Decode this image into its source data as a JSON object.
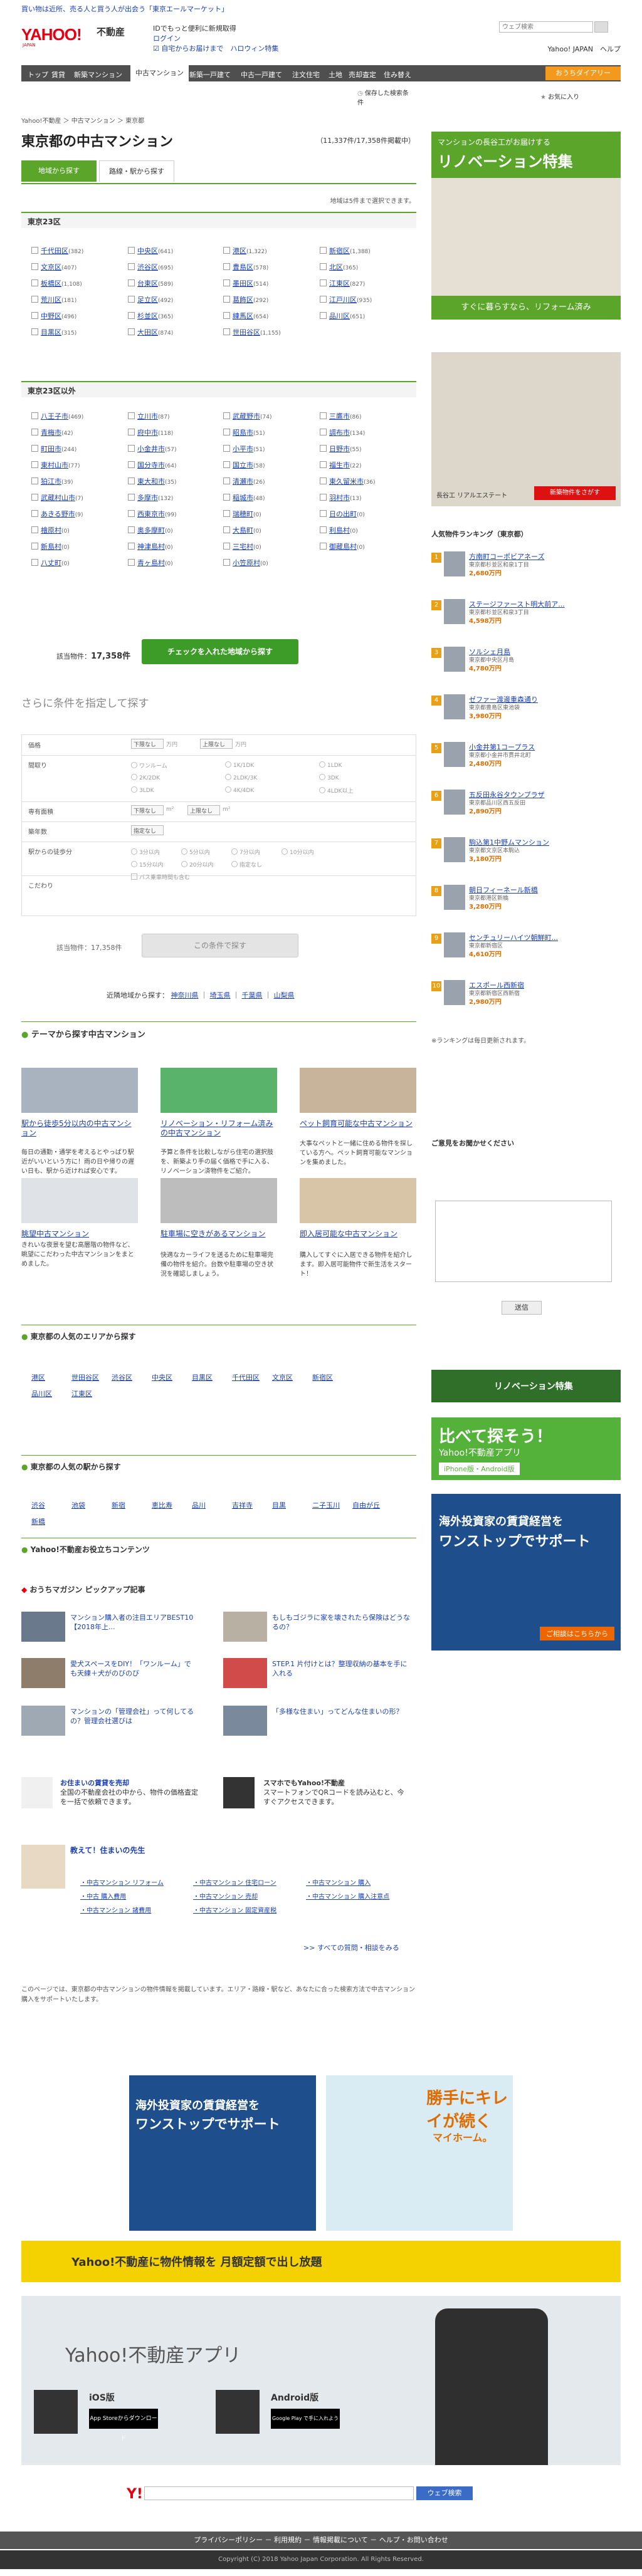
{
  "top_notice": "買い物は近所、売る人と買う人が出会う「東京エールマーケット」",
  "header": {
    "logo": "YAHOO!",
    "logo_sub": "JAPAN",
    "logo_fd": "不動産",
    "link1": "IDでもっと便利に新規取得",
    "link2": "ログイン",
    "link3": "☑ 自宅からお届けまで　ハロウィン特集",
    "search_placeholder": "ウェブ検索",
    "right_links": "Yahoo! JAPAN　ヘルプ"
  },
  "nav": {
    "items": [
      "トップ",
      "賃貸",
      "新築マンション",
      "中古マンション",
      "新築一戸建て",
      "中古一戸建て",
      "注文住宅",
      "土地",
      "売却査定",
      "住み替え"
    ],
    "okini": "おうちダイアリー"
  },
  "subnav": {
    "history": "保存した検索条件",
    "favorite": "お気に入り"
  },
  "breadcrumb": "Yahoo!不動産 ＞ 中古マンション ＞ 東京都",
  "page_title": "東京都の中古マンション",
  "count_line": "（11,337件/17,358件掲載中）",
  "tabs": {
    "area": "地域から探す",
    "train": "路線・駅から探す"
  },
  "area_note": "地域は5件まで選択できます。",
  "sec23": "東京23区",
  "wards23": [
    [
      "千代田区",
      "(382)"
    ],
    [
      "中央区",
      "(641)"
    ],
    [
      "港区",
      "(1,322)"
    ],
    [
      "新宿区",
      "(1,388)"
    ],
    [
      "文京区",
      "(407)"
    ],
    [
      "渋谷区",
      "(695)"
    ],
    [
      "豊島区",
      "(578)"
    ],
    [
      "北区",
      "(365)"
    ],
    [
      "板橋区",
      "(1,108)"
    ],
    [
      "台東区",
      "(589)"
    ],
    [
      "墨田区",
      "(514)"
    ],
    [
      "江東区",
      "(827)"
    ],
    [
      "荒川区",
      "(181)"
    ],
    [
      "足立区",
      "(492)"
    ],
    [
      "葛飾区",
      "(292)"
    ],
    [
      "江戸川区",
      "(935)"
    ],
    [
      "中野区",
      "(496)"
    ],
    [
      "杉並区",
      "(365)"
    ],
    [
      "練馬区",
      "(654)"
    ],
    [
      "品川区",
      "(651)"
    ],
    [
      "目黒区",
      "(315)"
    ],
    [
      "大田区",
      "(874)"
    ],
    [
      "世田谷区",
      "(1,155)"
    ],
    [
      "",
      ""
    ]
  ],
  "secOther": "東京23区以外",
  "wardsOther": [
    [
      "八王子市",
      "(469)"
    ],
    [
      "立川市",
      "(87)"
    ],
    [
      "武蔵野市",
      "(74)"
    ],
    [
      "三鷹市",
      "(86)"
    ],
    [
      "青梅市",
      "(42)"
    ],
    [
      "府中市",
      "(118)"
    ],
    [
      "昭島市",
      "(51)"
    ],
    [
      "調布市",
      "(134)"
    ],
    [
      "町田市",
      "(244)"
    ],
    [
      "小金井市",
      "(57)"
    ],
    [
      "小平市",
      "(51)"
    ],
    [
      "日野市",
      "(55)"
    ],
    [
      "東村山市",
      "(77)"
    ],
    [
      "国分寺市",
      "(64)"
    ],
    [
      "国立市",
      "(58)"
    ],
    [
      "福生市",
      "(22)"
    ],
    [
      "狛江市",
      "(39)"
    ],
    [
      "東大和市",
      "(35)"
    ],
    [
      "清瀬市",
      "(26)"
    ],
    [
      "東久留米市",
      "(36)"
    ],
    [
      "武蔵村山市",
      "(7)"
    ],
    [
      "多摩市",
      "(132)"
    ],
    [
      "稲城市",
      "(48)"
    ],
    [
      "羽村市",
      "(13)"
    ],
    [
      "あきる野市",
      "(9)"
    ],
    [
      "西東京市",
      "(99)"
    ],
    [
      "瑞穂町",
      "(0)"
    ],
    [
      "日の出町",
      "(0)"
    ],
    [
      "檜原村",
      "(0)"
    ],
    [
      "奥多摩町",
      "(0)"
    ],
    [
      "大島町",
      "(0)"
    ],
    [
      "利島村",
      "(0)"
    ],
    [
      "新島村",
      "(0)"
    ],
    [
      "神津島村",
      "(0)"
    ],
    [
      "三宅村",
      "(0)"
    ],
    [
      "御蔵島村",
      "(0)"
    ],
    [
      "八丈町",
      "(0)"
    ],
    [
      "青ヶ島村",
      "(0)"
    ],
    [
      "小笠原村",
      "(0)"
    ],
    [
      "",
      ""
    ]
  ],
  "hit_count_label": "該当物件：",
  "hit_count": "17,358件",
  "check_btn": "チェックを入れた地域から探す",
  "more_cond_title": "さらに条件を指定して探す",
  "cond_labels": [
    "価格",
    "間取り",
    "専有面積",
    "築年数",
    "駅からの徒歩分",
    "こだわり"
  ],
  "cond_select_min": "下限なし",
  "cond_select_max": "上限なし",
  "cond_unit_price": "万円",
  "cond_unit_area": "m²",
  "layout_opts": [
    "ワンルーム",
    "1K/1DK",
    "1LDK",
    "2K/2DK",
    "2LDK/3K",
    "3DK",
    "3LDK",
    "4K/4DK",
    "4LDK以上"
  ],
  "age_select": "指定なし",
  "walk_opts": [
    "3分以内",
    "5分以内",
    "7分以内",
    "10分以内",
    "15分以内",
    "20分以内",
    "指定なし"
  ],
  "special_opt": "バス乗車時間も含む",
  "search_btn": "この条件で探す",
  "nearby_label": "近隣地域から探す：",
  "nearby": [
    "神奈川県",
    "埼玉県",
    "千葉県",
    "山梨県"
  ],
  "theme_title": "テーマから探す中古マンション",
  "themes": [
    {
      "h": "駅から徒歩5分以内の中古マンション",
      "p": "毎日の通勤・通学を考えるとやっぱり駅近がいいという方に！雨の日や帰りの遅い日も、駅から近ければ安心です。"
    },
    {
      "h": "リノベーション・リフォーム済みの中古マンション",
      "p": "予算と条件を比較しながら住宅の選択肢を、新築より手の届く価格で手に入る、リノベーション済物件をご紹介。"
    },
    {
      "h": "ペット飼育可能な中古マンション",
      "p": "大事なペットと一緒に住める物件を探している方へ。ペット飼育可能なマンションを集めました。"
    },
    {
      "h": "眺望中古マンション",
      "p": "きれいな夜景を望む高層階の物件など、眺望にこだわった中古マンションをまとめました。"
    },
    {
      "h": "駐車場に空きがあるマンション",
      "p": "快適なカーライフを送るために駐車場完備の物件を紹介。台数や駐車場の空き状況を確認しましょう。"
    },
    {
      "h": "即入居可能な中古マンション",
      "p": "購入してすぐに入居できる物件を紹介します。即入居可能物件で新生活をスタート！"
    }
  ],
  "popular_area_title": "東京都の人気のエリアから探す",
  "popular_areas": [
    "港区",
    "世田谷区",
    "渋谷区",
    "中央区",
    "目黒区",
    "千代田区",
    "文京区",
    "新宿区",
    "品川区",
    "江東区"
  ],
  "popular_station_title": "東京都の人気の駅から探す",
  "popular_stations": [
    "渋谷",
    "池袋",
    "新宿",
    "恵比寿",
    "品川",
    "吉祥寺",
    "目黒",
    "二子玉川",
    "自由が丘",
    "新橋"
  ],
  "useful_title": "Yahoo!不動産お役立ちコンテンツ",
  "ouchi_title": "おうちマガジン ピックアップ記事",
  "articles": [
    "マンション購入者の注目エリアBEST10【2018年上...",
    "もしもゴジラに家を壊されたら保険はどうなるの？",
    "愛犬スペースをDIY！「ワンルーム」でも天練＋犬がのびのび",
    "STEP.1 片付けとは？整理収納の基本を手に入れる",
    "マンションの「管理会社」って何してるの？管理会社選びは",
    "「多様な住まい」ってどんな住まいの形？"
  ],
  "bottom_info": [
    {
      "h": "お住まいの賃貸を売却",
      "p": "全国の不動産会社の中から、物件の価格査定を一括で依頼できます。"
    },
    {
      "h": "スマホでもYahoo!不動産",
      "p": "スマートフォンでQRコードを読み込むと、今すぐアクセスできます。"
    }
  ],
  "teacher_title": "教えて！住まいの先生",
  "teacher_links": [
    "中古マンション リフォーム",
    "中古マンション 住宅ローン",
    "中古マンション 購入",
    "中古 購入費用",
    "中古マンション 売却",
    "中古マンション 購入注意点",
    "中古マンション 諸費用",
    "中古マンション 固定資産税"
  ],
  "teacher_more": "すべての質問・相談をみる",
  "page_note": "このページでは、東京都の中古マンションの物件情報を掲載しています。エリア・路線・駅など、あなたに合った検索方法で中古マンション購入をサポートいたします。",
  "sidebar": {
    "ad1_title": "マンションの長谷工がお届けする",
    "ad1_big": "リノベーション特集",
    "ad1_sub": "すぐに暮らすなら、リフォーム済み",
    "ad2_brand": "長谷工 リアルエステート",
    "ad2_btn": "新築物件をさがす",
    "rank_title": "人気物件ランキング（東京都）",
    "ranks": [
      {
        "n": "1",
        "name": "方南町コーポビアネーズ",
        "sub": "東京都杉並区和泉1丁目",
        "price": "2,680万円"
      },
      {
        "n": "2",
        "name": "ステージファースト明大前ア...",
        "sub": "東京都杉並区和泉3丁目",
        "price": "4,598万円"
      },
      {
        "n": "3",
        "name": "ソルシェ月島",
        "sub": "東京都中央区月島",
        "price": "4,780万円"
      },
      {
        "n": "4",
        "name": "ゼファー渡邊重森通り",
        "sub": "東京都豊島区東池袋",
        "price": "3,980万円"
      },
      {
        "n": "5",
        "name": "小金井第1コープラス",
        "sub": "東京都小金井市貫井北町",
        "price": "2,480万円"
      },
      {
        "n": "6",
        "name": "五反田永谷タウンプラザ",
        "sub": "東京都品川区西五反田",
        "price": "2,890万円"
      },
      {
        "n": "7",
        "name": "駒込第1中野ムマンション",
        "sub": "東京都文京区本駒込",
        "price": "3,180万円"
      },
      {
        "n": "8",
        "name": "朝日フィーネール新橋",
        "sub": "東京都港区新橋",
        "price": "3,280万円"
      },
      {
        "n": "9",
        "name": "センチュリーハイツ朝鮮町...",
        "sub": "東京都新宿区",
        "price": "4,610万円"
      },
      {
        "n": "10",
        "name": "エスポール西新宿",
        "sub": "東京都新宿区西新宿",
        "price": "2,980万円"
      }
    ],
    "rank_note": "※ランキングは毎日更新されます。",
    "feedback_title": "ご意見をお聞かせください",
    "feedback_btn": "送信",
    "renov_banner": "リノベーション特集",
    "app_banner_big": "比べて探そう！",
    "app_banner_sub": "Yahoo!不動産アプリ",
    "app_banner_btn": "iPhone版・Android版",
    "ad3_title": "海外投資家の賃貸経営を",
    "ad3_title2": "ワンストップでサポート",
    "ad3_btn": "ご相談はこちらから"
  },
  "bottom_ads": {
    "left_title": "海外投資家の賃貸経営を",
    "left_title2": "ワンストップでサポート",
    "right_title": "勝手にキレイが続く",
    "right_title2": "マイホーム。",
    "banner_text": "Yahoo!不動産に物件情報を 月額定額で出し放題"
  },
  "app_section": {
    "title": "Yahoo!不動産アプリ",
    "ios": "iOS版",
    "android": "Android版",
    "appstore": "App Storeからダウンロード",
    "googleplay": "Google Play で手に入れよう"
  },
  "footer": {
    "search_btn": "ウェブ検索",
    "nav": "プライバシーポリシー － 利用規約 － 情報掲載について － ヘルプ・お問い合わせ",
    "copyright": "Copyright (C) 2018 Yahoo Japan Corporation. All Rights Reserved."
  }
}
